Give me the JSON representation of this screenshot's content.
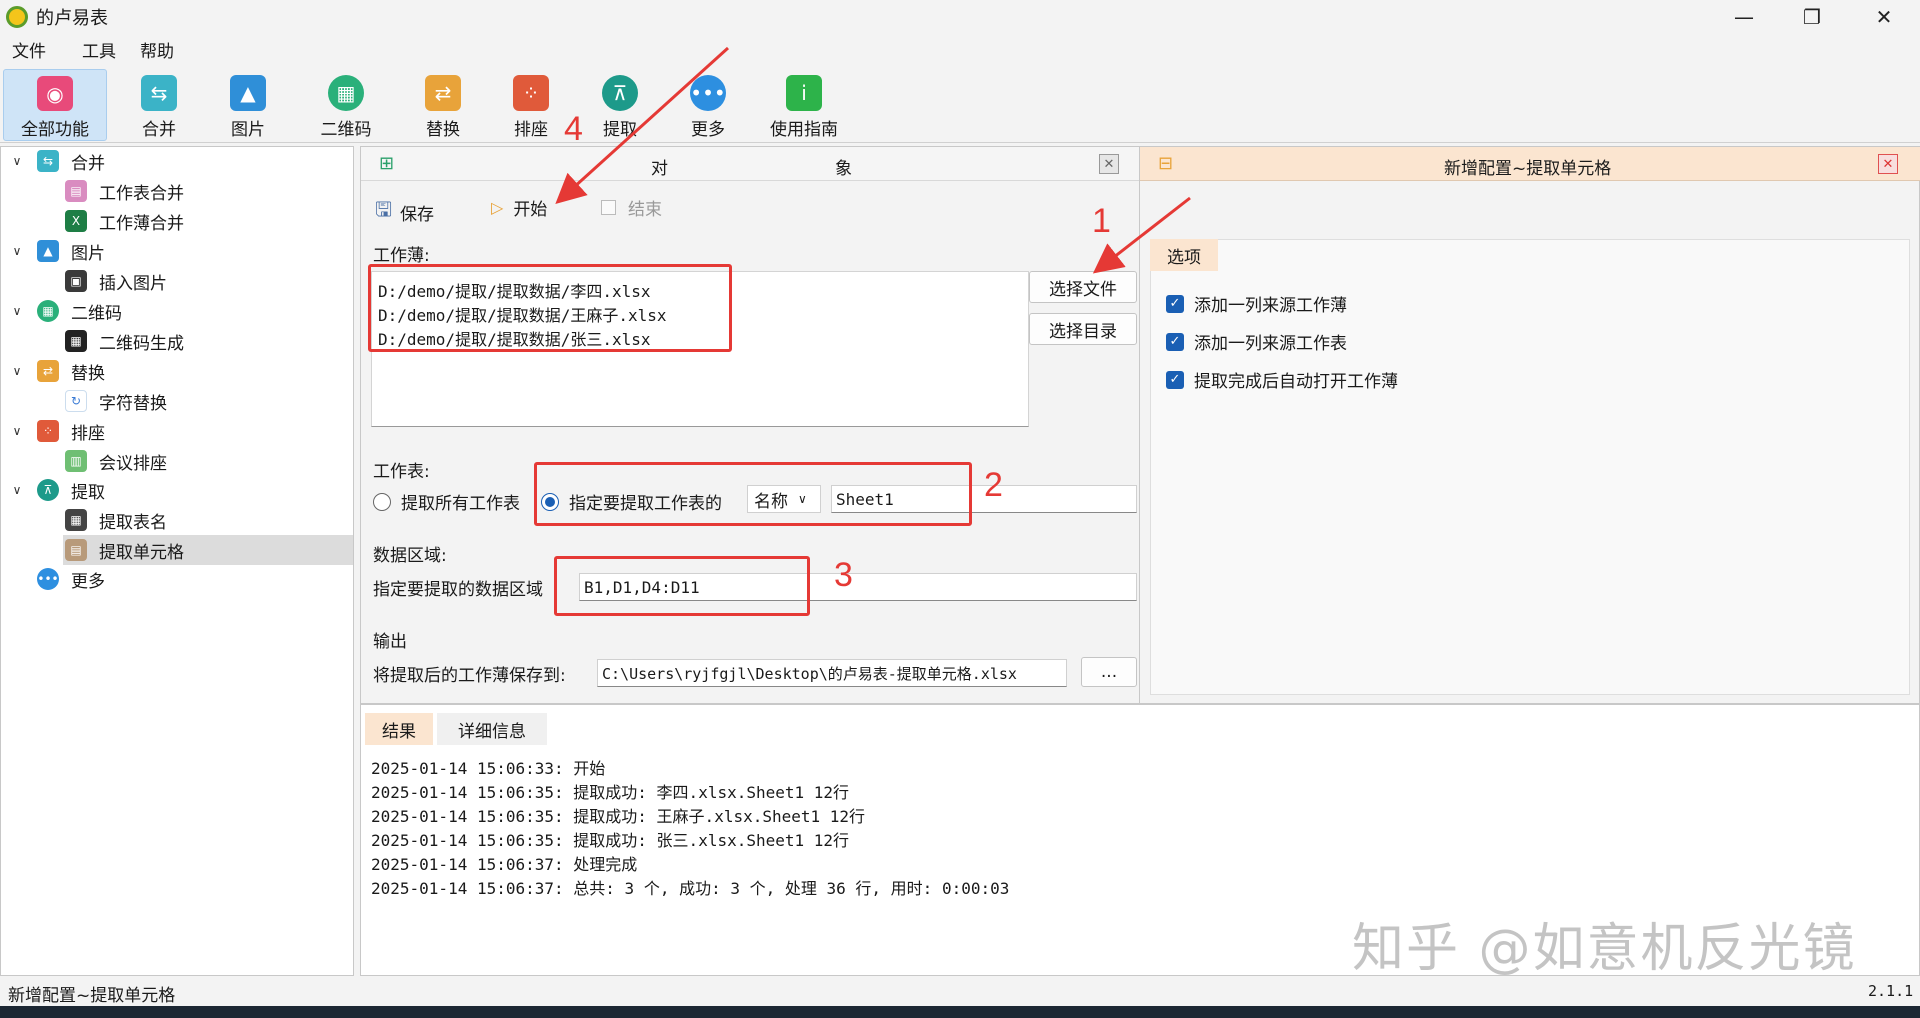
{
  "window": {
    "title": "的卢易表",
    "minimize": "—",
    "maximize": "❐",
    "close": "✕"
  },
  "menu": [
    "文件",
    "工具",
    "帮助"
  ],
  "toolbar": [
    {
      "label": "全部功能",
      "icon": "eye-icon",
      "color": "#e84a7a"
    },
    {
      "label": "合并",
      "icon": "merge-icon",
      "color": "#3bb3c7"
    },
    {
      "label": "图片",
      "icon": "picture-icon",
      "color": "#2f8fd8"
    },
    {
      "label": "二维码",
      "icon": "qrcode-icon",
      "color": "#2ab07a"
    },
    {
      "label": "替换",
      "icon": "replace-icon",
      "color": "#e8a33a"
    },
    {
      "label": "排座",
      "icon": "seating-icon",
      "color": "#e05a3a"
    },
    {
      "label": "提取",
      "icon": "extract-icon",
      "color": "#1d9a8a"
    },
    {
      "label": "更多",
      "icon": "more-icon",
      "color": "#2d8fe0"
    },
    {
      "label": "使用指南",
      "icon": "guide-icon",
      "color": "#2db34a"
    }
  ],
  "tree": {
    "groups": [
      {
        "label": "合并",
        "icon": "merge-icon",
        "children": [
          "工作表合并",
          "工作薄合并"
        ]
      },
      {
        "label": "图片",
        "icon": "picture-icon",
        "children": [
          "插入图片"
        ]
      },
      {
        "label": "二维码",
        "icon": "qrcode-icon",
        "children": [
          "二维码生成"
        ]
      },
      {
        "label": "替换",
        "icon": "replace-icon",
        "children": [
          "字符替换"
        ]
      },
      {
        "label": "排座",
        "icon": "seating-icon",
        "children": [
          "会议排座"
        ]
      },
      {
        "label": "提取",
        "icon": "extract-icon",
        "children": [
          "提取表名",
          "提取单元格"
        ]
      }
    ],
    "more": "更多"
  },
  "object_panel": {
    "title_left": "对",
    "title_right": "象",
    "save": "保存",
    "start": "开始",
    "end": "结束",
    "workbook_label": "工作薄:",
    "files": [
      "D:/demo/提取/提取数据/李四.xlsx",
      "D:/demo/提取/提取数据/王麻子.xlsx",
      "D:/demo/提取/提取数据/张三.xlsx"
    ],
    "choose_file": "选择文件",
    "choose_dir": "选择目录",
    "sheet_label": "工作表:",
    "radio_all": "提取所有工作表",
    "radio_specify": "指定要提取工作表的",
    "name_select": "名称",
    "sheet_value": "Sheet1",
    "range_label": "数据区域:",
    "range_prompt": "指定要提取的数据区域",
    "range_value": "B1,D1,D4:D11",
    "output_label": "输出",
    "output_prompt": "将提取后的工作薄保存到:",
    "output_value": "C:\\Users\\ryjfgjl\\Desktop\\的卢易表-提取单元格.xlsx",
    "browse": "..."
  },
  "config_panel": {
    "title": "新增配置~提取单元格",
    "tab": "选项",
    "options": [
      "添加一列来源工作薄",
      "添加一列来源工作表",
      "提取完成后自动打开工作薄"
    ]
  },
  "annotations": [
    "1",
    "2",
    "3",
    "4"
  ],
  "result": {
    "tabs": [
      "结果",
      "详细信息"
    ],
    "log": [
      "2025-01-14 15:06:33: 开始",
      "2025-01-14 15:06:35: 提取成功: 李四.xlsx.Sheet1 12行",
      "2025-01-14 15:06:35: 提取成功: 王麻子.xlsx.Sheet1 12行",
      "2025-01-14 15:06:35: 提取成功: 张三.xlsx.Sheet1 12行",
      "2025-01-14 15:06:37: 处理完成",
      "2025-01-14 15:06:37: 总共: 3 个, 成功: 3 个, 处理 36 行, 用时: 0:00:03"
    ]
  },
  "status": {
    "left": "新增配置~提取单元格",
    "version": "2.1.1"
  },
  "watermark": "知乎 @如意机反光镜",
  "colors": {
    "accent": "#1a5fb4",
    "annotation": "#e53935",
    "config_header": "#fbe5d0"
  }
}
